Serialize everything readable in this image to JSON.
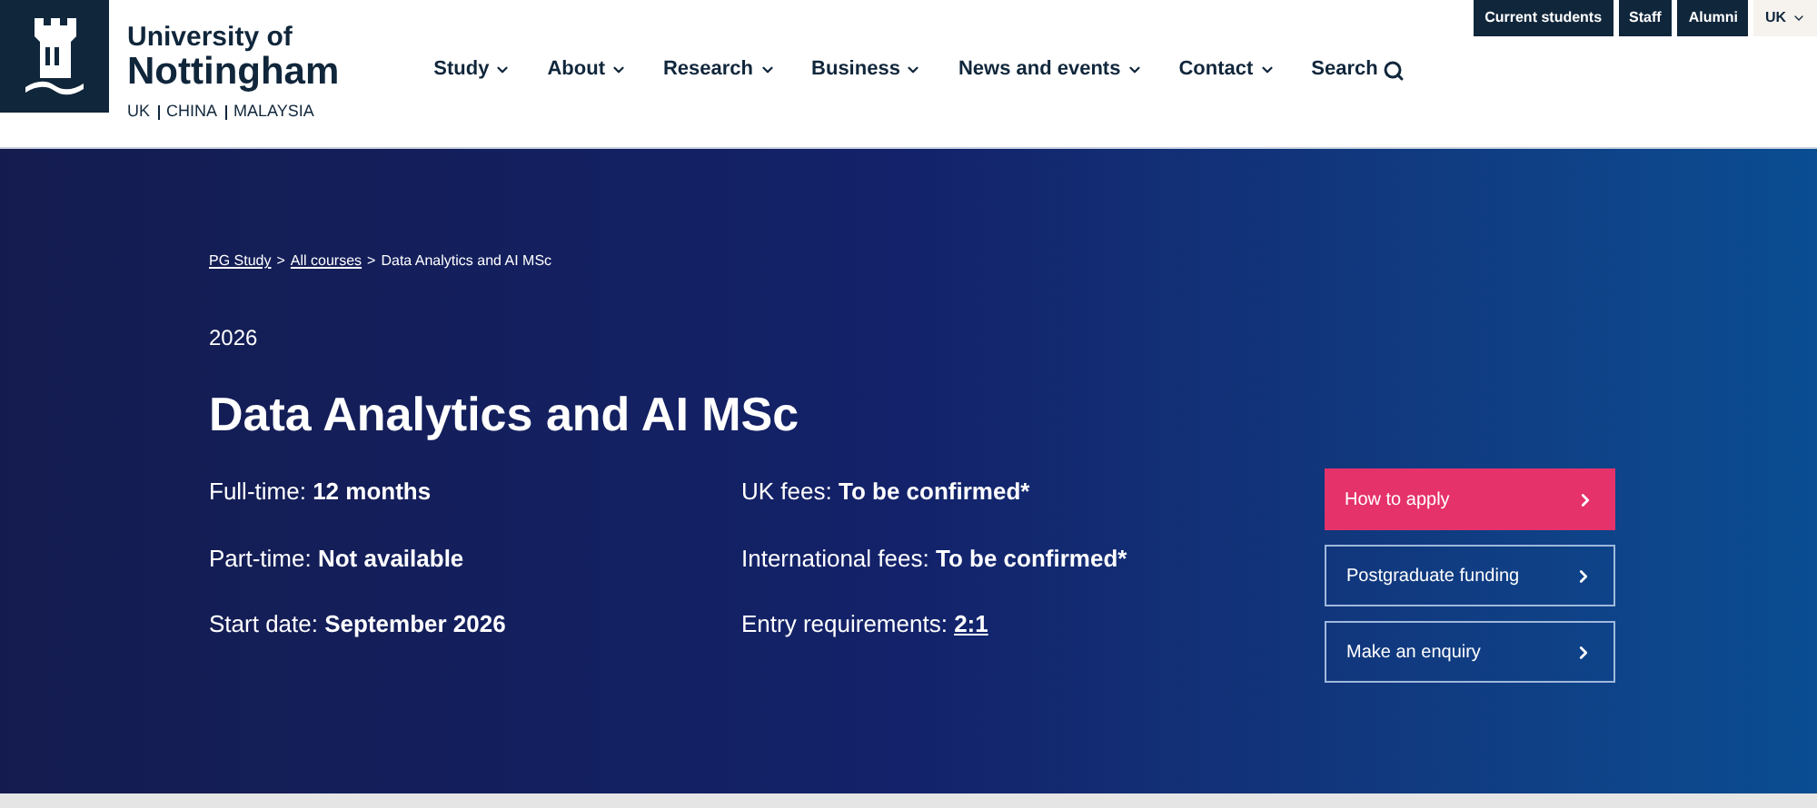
{
  "logo": {
    "line_1": "University of",
    "line_2": "Nottingham",
    "campuses": [
      "UK",
      "CHINA",
      "MALAYSIA"
    ]
  },
  "utility_links": [
    {
      "label": "Current students",
      "kind": "dark"
    },
    {
      "label": "Staff",
      "kind": "dark"
    },
    {
      "label": "Alumni",
      "kind": "dark"
    },
    {
      "label": "UK",
      "kind": "light"
    }
  ],
  "nav": [
    {
      "label": "Study",
      "kind": "menu"
    },
    {
      "label": "About",
      "kind": "menu"
    },
    {
      "label": "Research",
      "kind": "menu"
    },
    {
      "label": "Business",
      "kind": "menu"
    },
    {
      "label": "News and events",
      "kind": "menu"
    },
    {
      "label": "Contact",
      "kind": "menu"
    },
    {
      "label": "Search",
      "kind": "search"
    }
  ],
  "breadcrumb_separator": ">",
  "breadcrumb": [
    {
      "label": "PG Study",
      "kind": "link"
    },
    {
      "label": "All courses",
      "kind": "link"
    },
    {
      "label": "Data Analytics and AI MSc",
      "kind": "current"
    }
  ],
  "year": "2026",
  "title": "Data Analytics and AI MSc",
  "facts_left": [
    {
      "label": "Full-time:",
      "value": "12 months",
      "kind": "text"
    },
    {
      "label": "Part-time:",
      "value": "Not available",
      "kind": "text"
    },
    {
      "label": "Start date:",
      "value": "September 2026",
      "kind": "text"
    }
  ],
  "facts_right": [
    {
      "label": "UK fees:",
      "value": "To be confirmed*",
      "kind": "text"
    },
    {
      "label": "International fees:",
      "value": "To be confirmed*",
      "kind": "text"
    },
    {
      "label": "Entry requirements:",
      "value": "2:1",
      "kind": "link"
    }
  ],
  "actions": [
    {
      "label": "How to apply",
      "kind": "primary"
    },
    {
      "label": "Postgraduate funding",
      "kind": "outline"
    },
    {
      "label": "Make an enquiry",
      "kind": "outline"
    }
  ]
}
